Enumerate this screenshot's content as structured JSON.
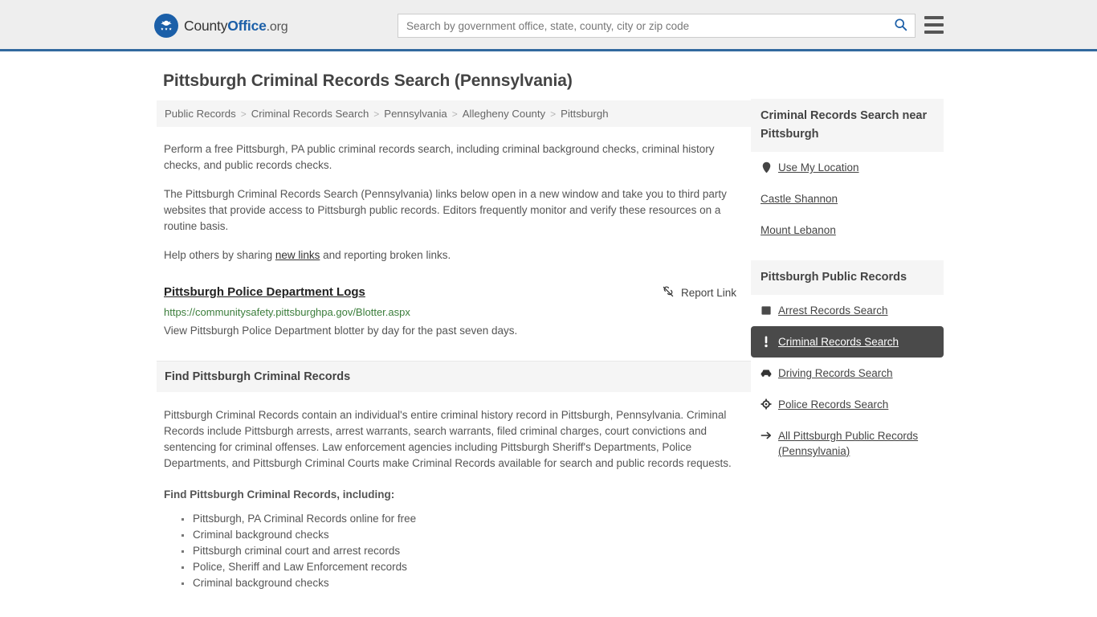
{
  "header": {
    "logo": {
      "part1": "County",
      "part2": "Office",
      "part3": ".org",
      "icon": "eagle-seal-icon"
    },
    "search": {
      "placeholder": "Search by government office, state, county, city or zip code",
      "value": "",
      "button_icon": "search-icon"
    },
    "menu_icon": "hamburger-menu-icon",
    "accent_color": "#32699e"
  },
  "page": {
    "title": "Pittsburgh Criminal Records Search (Pennsylvania)"
  },
  "breadcrumb": {
    "separator": ">",
    "items": [
      {
        "label": "Public Records"
      },
      {
        "label": "Criminal Records Search"
      },
      {
        "label": "Pennsylvania"
      },
      {
        "label": "Allegheny County"
      },
      {
        "label": "Pittsburgh"
      }
    ]
  },
  "intro": {
    "p1": "Perform a free Pittsburgh, PA public criminal records search, including criminal background checks, criminal history checks, and public records checks.",
    "p2": "The Pittsburgh Criminal Records Search (Pennsylvania) links below open in a new window and take you to third party websites that provide access to Pittsburgh public records. Editors frequently monitor and verify these resources on a routine basis.",
    "p3_before": "Help others by sharing ",
    "p3_link": "new links",
    "p3_after": " and reporting broken links."
  },
  "result": {
    "title": "Pittsburgh Police Department Logs",
    "url": "https://communitysafety.pittsburghpa.gov/Blotter.aspx",
    "description": "View Pittsburgh Police Department blotter by day for the past seven days.",
    "report_label": "Report Link",
    "report_icon": "broken-link-icon",
    "url_color": "#3b7d3b"
  },
  "section": {
    "heading": "Find Pittsburgh Criminal Records",
    "paragraph": "Pittsburgh Criminal Records contain an individual's entire criminal history record in Pittsburgh, Pennsylvania. Criminal Records include Pittsburgh arrests, arrest warrants, search warrants, filed criminal charges, court convictions and sentencing for criminal offenses. Law enforcement agencies including Pittsburgh Sheriff's Departments, Police Departments, and Pittsburgh Criminal Courts make Criminal Records available for search and public records requests.",
    "sub_heading": "Find Pittsburgh Criminal Records, including:",
    "bullets": [
      "Pittsburgh, PA Criminal Records online for free",
      "Criminal background checks",
      "Pittsburgh criminal court and arrest records",
      "Police, Sheriff and Law Enforcement records",
      "Criminal background checks"
    ]
  },
  "rail": {
    "near_card": {
      "heading": "Criminal Records Search near Pittsburgh",
      "items": [
        {
          "label": "Use My Location",
          "icon": "map-pin-icon"
        },
        {
          "label": "Castle Shannon",
          "icon": ""
        },
        {
          "label": "Mount Lebanon",
          "icon": ""
        }
      ]
    },
    "public_records_card": {
      "heading": "Pittsburgh Public Records",
      "active_color": "#4a4a4a",
      "items": [
        {
          "label": "Arrest Records Search",
          "icon": "fingerprint-icon",
          "active": false
        },
        {
          "label": "Criminal Records Search",
          "icon": "exclamation-icon",
          "active": true
        },
        {
          "label": "Driving Records Search",
          "icon": "car-icon",
          "active": false
        },
        {
          "label": "Police Records Search",
          "icon": "police-badge-icon",
          "active": false
        },
        {
          "label": "All Pittsburgh Public Records (Pennsylvania)",
          "icon": "arrow-right-icon",
          "active": false
        }
      ]
    }
  }
}
